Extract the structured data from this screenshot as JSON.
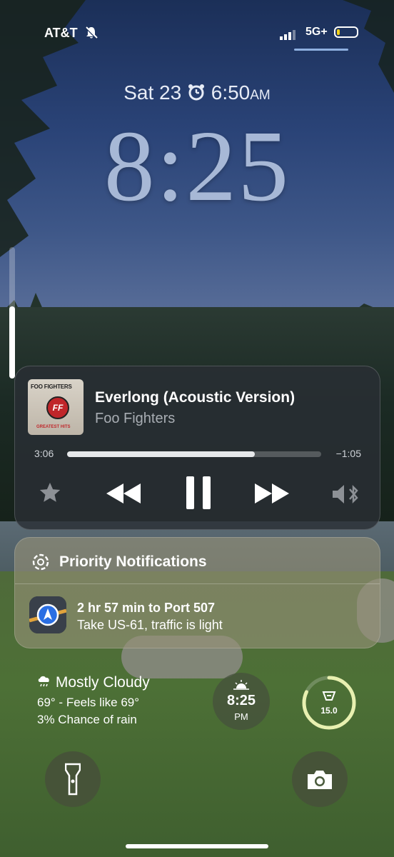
{
  "status_bar": {
    "carrier": "AT&T",
    "network": "5G+",
    "icons": [
      "bell-slash-icon",
      "signal-icon",
      "battery-icon"
    ],
    "battery_level": 0.15,
    "battery_color": "#f4d21a"
  },
  "lock_screen": {
    "date": "Sat 23",
    "alarm_time": "6:50",
    "alarm_ampm": "AM",
    "time": "8:25"
  },
  "volume_level": 0.55,
  "now_playing": {
    "album_band": "FOO FIGHTERS",
    "album_logo": "FF",
    "album_subtitle": "GREATEST HITS",
    "title": "Everlong (Acoustic Version)",
    "artist": "Foo Fighters",
    "elapsed": "3:06",
    "remaining": "−1:05",
    "progress": 0.74,
    "controls": [
      "star-icon",
      "rewind-icon",
      "pause-icon",
      "fast-forward-icon",
      "bluetooth-speaker-icon"
    ]
  },
  "notifications": {
    "header": "Priority Notifications",
    "items": [
      {
        "app_icon": "maps-icon",
        "title": "2 hr 57 min to Port 507",
        "body": "Take US-61, traffic is light"
      }
    ]
  },
  "widgets": {
    "weather": {
      "condition": "Mostly Cloudy",
      "temp_line": "69° - Feels like 69°",
      "rain_line": "3% Chance of rain"
    },
    "sunset": {
      "time": "8:25",
      "ampm": "PM"
    },
    "ring": {
      "value": "15.0",
      "fill": 0.82,
      "color": "#e8f0b0"
    }
  },
  "quick_actions": [
    "flashlight-icon",
    "camera-icon"
  ]
}
